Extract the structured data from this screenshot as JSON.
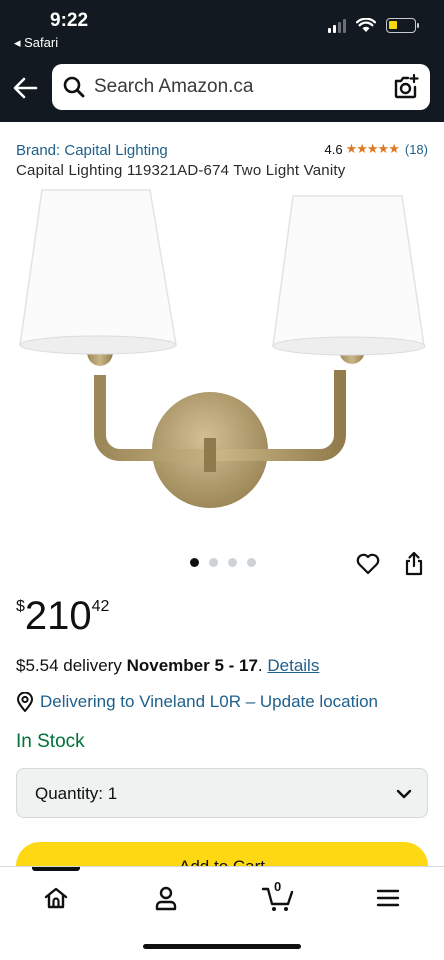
{
  "status_bar": {
    "time": "9:22",
    "back_app": "◂ Safari"
  },
  "header": {
    "search_placeholder": "Search Amazon.ca",
    "bg_color": "#131921"
  },
  "product": {
    "brand_link": "Brand: Capital Lighting",
    "rating_value": "4.6",
    "rating_stars": "★★★★★",
    "rating_count": "(18)",
    "title": "Capital Lighting 119321AD-674 Two Light Vanity",
    "image_count": 4,
    "active_image_index": 0
  },
  "price": {
    "symbol": "$",
    "whole": "210",
    "fraction": "42"
  },
  "delivery": {
    "prefix": "$5.54 delivery ",
    "dates": "November 5 - 17",
    "separator": ". ",
    "details_link": "Details"
  },
  "location": {
    "text": "Delivering to Vineland L0R – Update location"
  },
  "stock": {
    "status": "In Stock",
    "color": "#00713b"
  },
  "quantity": {
    "label": "Quantity: 1"
  },
  "add_to_cart": {
    "label": "Add to Cart",
    "color": "#ffd814"
  },
  "bottom_nav": {
    "cart_count": "0",
    "items": [
      "home-icon",
      "account-icon",
      "cart-icon",
      "menu-icon"
    ]
  },
  "colors": {
    "link": "#1f5f8b",
    "star": "#de7921"
  }
}
